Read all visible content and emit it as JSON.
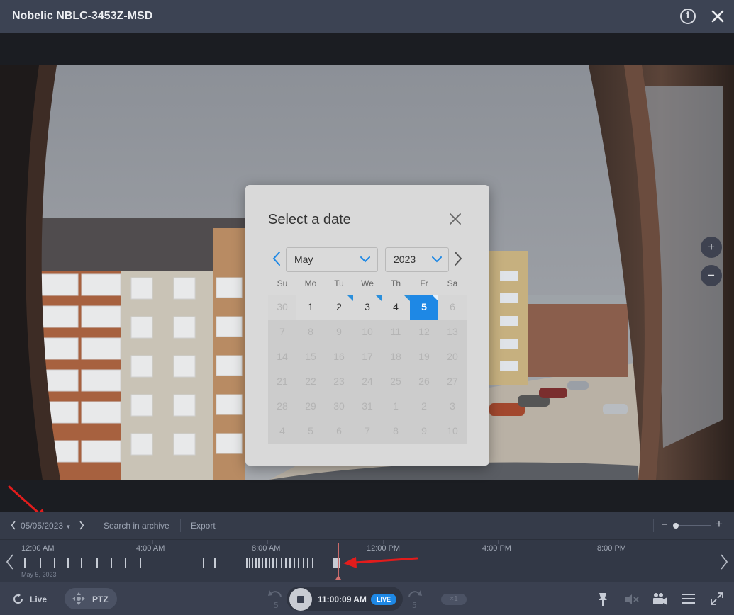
{
  "window": {
    "title": "Nobelic NBLC-3453Z-MSD"
  },
  "date_dialog": {
    "title": "Select a date",
    "month": "May",
    "year": "2023",
    "weekdays": [
      "Su",
      "Mo",
      "Tu",
      "We",
      "Th",
      "Fr",
      "Sa"
    ],
    "days": [
      {
        "label": "30",
        "state": "outside"
      },
      {
        "label": "1",
        "state": "active"
      },
      {
        "label": "2",
        "state": "recorded"
      },
      {
        "label": "3",
        "state": "recorded"
      },
      {
        "label": "4",
        "state": "recorded"
      },
      {
        "label": "5",
        "state": "selected"
      },
      {
        "label": "6",
        "state": "disabled"
      },
      {
        "label": "7",
        "state": "disabled"
      },
      {
        "label": "8",
        "state": "disabled"
      },
      {
        "label": "9",
        "state": "disabled"
      },
      {
        "label": "10",
        "state": "disabled"
      },
      {
        "label": "11",
        "state": "disabled"
      },
      {
        "label": "12",
        "state": "disabled"
      },
      {
        "label": "13",
        "state": "disabled"
      },
      {
        "label": "14",
        "state": "disabled"
      },
      {
        "label": "15",
        "state": "disabled"
      },
      {
        "label": "16",
        "state": "disabled"
      },
      {
        "label": "17",
        "state": "disabled"
      },
      {
        "label": "18",
        "state": "disabled"
      },
      {
        "label": "19",
        "state": "disabled"
      },
      {
        "label": "20",
        "state": "disabled"
      },
      {
        "label": "21",
        "state": "disabled"
      },
      {
        "label": "22",
        "state": "disabled"
      },
      {
        "label": "23",
        "state": "disabled"
      },
      {
        "label": "24",
        "state": "disabled"
      },
      {
        "label": "25",
        "state": "disabled"
      },
      {
        "label": "26",
        "state": "disabled"
      },
      {
        "label": "27",
        "state": "disabled"
      },
      {
        "label": "28",
        "state": "disabled"
      },
      {
        "label": "29",
        "state": "disabled"
      },
      {
        "label": "30",
        "state": "disabled"
      },
      {
        "label": "31",
        "state": "disabled"
      },
      {
        "label": "1",
        "state": "disabled"
      },
      {
        "label": "2",
        "state": "disabled"
      },
      {
        "label": "3",
        "state": "disabled"
      },
      {
        "label": "4",
        "state": "disabled"
      },
      {
        "label": "5",
        "state": "disabled"
      },
      {
        "label": "6",
        "state": "disabled"
      },
      {
        "label": "7",
        "state": "disabled"
      },
      {
        "label": "8",
        "state": "disabled"
      },
      {
        "label": "9",
        "state": "disabled"
      },
      {
        "label": "10",
        "state": "disabled"
      }
    ]
  },
  "archive_toolbar": {
    "date": "05/05/2023",
    "search_label": "Search in archive",
    "export_label": "Export"
  },
  "timeline": {
    "labels": [
      "12:00 AM",
      "4:00 AM",
      "8:00 AM",
      "12:00 PM",
      "4:00 PM",
      "8:00 PM"
    ],
    "date_caption": "May 5, 2023"
  },
  "bottom_bar": {
    "live_label": "Live",
    "ptz_label": "PTZ",
    "current_time": "11:00:09 AM",
    "live_badge": "LIVE",
    "speed_label": "×1"
  },
  "colors": {
    "accent": "#1e88e5",
    "annotation_arrow": "#e21c1c",
    "titlebar": "#3c4353"
  },
  "icons": [
    "info-icon",
    "close-icon",
    "zoom-in-icon",
    "zoom-out-icon",
    "chevron-left-icon",
    "chevron-right-icon",
    "chevron-down-icon",
    "live-icon",
    "ptz-icon",
    "rewind-icon",
    "stop-icon",
    "forward-icon",
    "pin-icon",
    "mute-icon",
    "camera-icon",
    "menu-icon",
    "fullscreen-icon"
  ]
}
